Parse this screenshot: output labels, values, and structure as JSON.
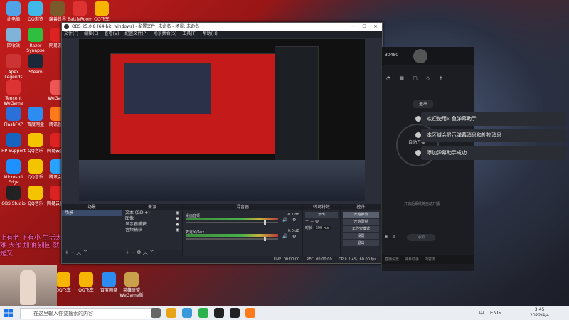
{
  "desktop_icons": [
    {
      "label": "此电脑",
      "color": "#4fa3e6"
    },
    {
      "label": "QQ浏览",
      "color": "#40b8e8"
    },
    {
      "label": "魔兽世界",
      "color": "#7a5a2a"
    },
    {
      "label": "BattleRoom",
      "color": "#d33"
    },
    {
      "label": "QQ飞车",
      "color": "#f5b500"
    },
    {
      "label": "回收站",
      "color": "#7fb3d8"
    },
    {
      "label": "Razer Synapse",
      "color": "#2fbf3f"
    },
    {
      "label": "网易游戏",
      "color": "#d22"
    },
    {
      "label": "Apex Legends",
      "color": "#c33"
    },
    {
      "label": "Steam",
      "color": "#1b2838"
    },
    {
      "label": "Tencent WeGame",
      "color": "#d33"
    },
    {
      "label": "WeGame",
      "color": "#e55"
    },
    {
      "label": "FlashFXP",
      "color": "#2a70d8"
    },
    {
      "label": "百度网盘",
      "color": "#2d8cf0"
    },
    {
      "label": "腾讯视频",
      "color": "#ff7a1a"
    },
    {
      "label": "HP Support",
      "color": "#1565c0"
    },
    {
      "label": "QQ音乐",
      "color": "#f5c400"
    },
    {
      "label": "网易云音乐",
      "color": "#d22"
    },
    {
      "label": "Microsoft Edge",
      "color": "#1e90ff"
    },
    {
      "label": "QQ音乐",
      "color": "#f5c400"
    },
    {
      "label": "腾讯会议",
      "color": "#2aa3ff"
    },
    {
      "label": "OBS Studio",
      "color": "#222"
    },
    {
      "label": "QQ音乐",
      "color": "#f5c400"
    },
    {
      "label": "网易云音乐",
      "color": "#d22"
    }
  ],
  "desktop_bottom_icons": [
    {
      "label": "QQ飞车",
      "color": "#f5b500"
    },
    {
      "label": "QQ飞车",
      "color": "#f5b500"
    },
    {
      "label": "百度网盘",
      "color": "#2d8cf0"
    },
    {
      "label": "英雄联盟 WeGame版",
      "color": "#c8a14a"
    }
  ],
  "obs": {
    "title": "OBS 25.0.8 (64-bit, windows) - 配置文件: 未命名 - 场景: 未命名",
    "menu": [
      "文件(F)",
      "编辑(E)",
      "查看(V)",
      "配置文件(P)",
      "场景集合(S)",
      "工具(T)",
      "帮助(H)"
    ],
    "dock_headers": {
      "scenes": "场景",
      "sources": "来源",
      "mixer": "混音器",
      "transitions": "转场特效",
      "controls": "控件"
    },
    "scenes": [
      "场景"
    ],
    "sources": [
      "文本 (GDI+)",
      "图像",
      "显示器捕获",
      "音频捕获"
    ],
    "mixer": [
      {
        "label": "桌面音频",
        "db": "-0.1 dB"
      },
      {
        "label": "麦克风/Aux",
        "db": "0.0 dB"
      }
    ],
    "transitions": {
      "label": "淡出",
      "duration_label": "时长",
      "duration": "300 ms"
    },
    "controls": [
      "开始推流",
      "开始录制",
      "工作室模式",
      "设置",
      "退出"
    ],
    "status": {
      "live": "LIVE: 00:00:00",
      "rec": "REC: 00:00:00",
      "cpu": "CPU: 1.4%, 60.00 fps"
    }
  },
  "phone_panel": {
    "header_num": "30480",
    "out_btn": "退出",
    "ring_text": "自动开播",
    "hint": "开启后系统将自动开播",
    "add_btn": "添加",
    "bottom_labels": [
      "直播设置",
      "弹幕助手",
      "内容流"
    ]
  },
  "notifications": [
    "欢迎使用斗鱼弹幕助手",
    "本区域会显示弹幕消息和礼物消息",
    "添加弹幕助手成功"
  ],
  "wall_text": "上有老 下有小 生活太难 大作 加油 别回 就是又",
  "taskbar": {
    "search_placeholder": "在这里输入你要搜索的内容",
    "time": "3:45",
    "date": "2022/4/4",
    "tray": [
      "中",
      "ENG"
    ]
  }
}
